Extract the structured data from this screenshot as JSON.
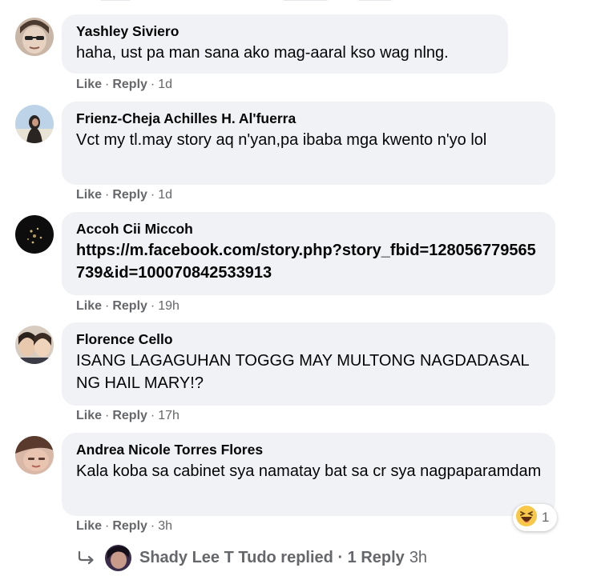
{
  "comments": [
    {
      "author": "Yashley Siviero",
      "text": "haha, ust pa man sana ako mag-aaral kso wag nlng.",
      "like": "Like",
      "reply": "Reply",
      "sep": "·",
      "time": "1d"
    },
    {
      "author": "Frienz-Cheja Achilles H. Al'fuerra",
      "text": "Vct my tl.may story aq n'yan,pa ibaba mga kwento n'yo lol",
      "like": "Like",
      "reply": "Reply",
      "sep": "·",
      "time": "1d"
    },
    {
      "author": "Accoh Cii Miccoh",
      "text": "https://m.facebook.com/story.php?story_fbid=128056779565739&id=100070842533913",
      "like": "Like",
      "reply": "Reply",
      "sep": "·",
      "time": "19h"
    },
    {
      "author": "Florence Cello",
      "text": "ISANG LAGAGUHAN TOGGG MAY MULTONG NAGDADASAL NG HAIL MARY!?",
      "like": "Like",
      "reply": "Reply",
      "sep": "·",
      "time": "17h"
    },
    {
      "author": "Andrea Nicole Torres Flores",
      "text": "Kala koba sa cabinet sya namatay bat sa cr sya nagpaparamdam",
      "like": "Like",
      "reply": "Reply",
      "sep": "·",
      "time": "3h"
    }
  ],
  "reaction": {
    "icon": "haha-emoji-icon",
    "count": "1"
  },
  "reply_summary": {
    "icon": "reply-arrow-icon",
    "text": "Shady Lee T Tudo replied · 1 Reply",
    "time": "3h"
  }
}
